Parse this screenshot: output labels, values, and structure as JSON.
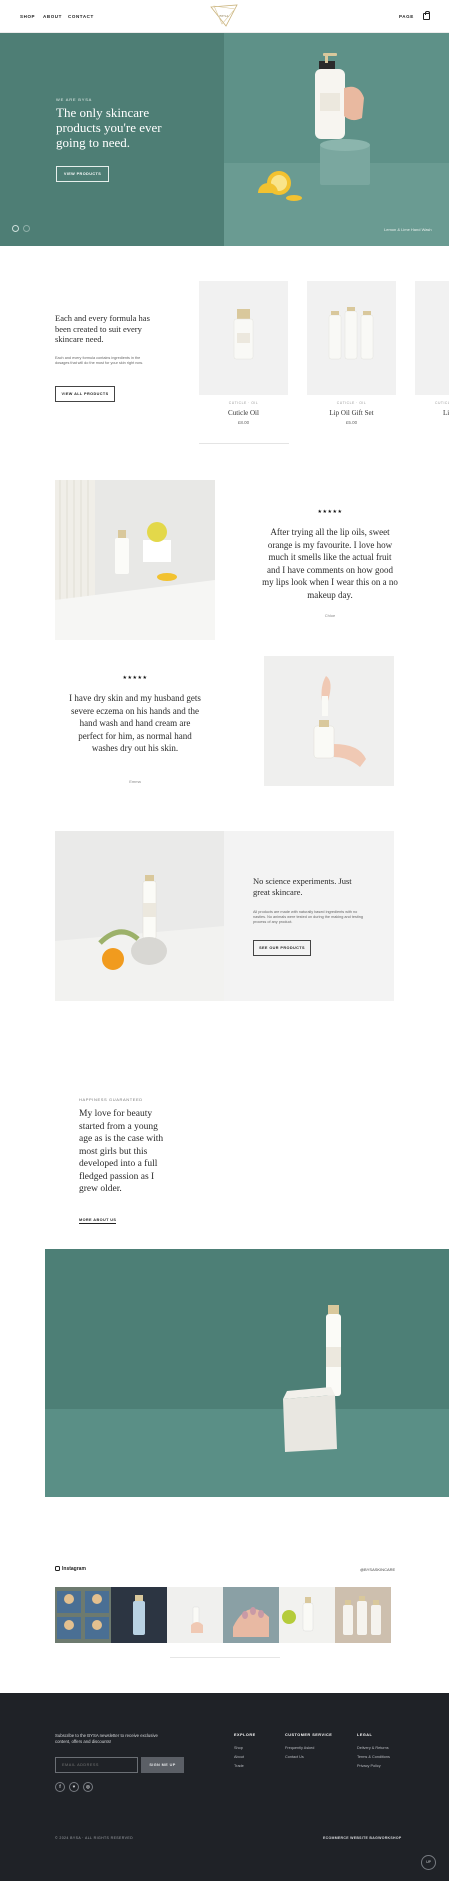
{
  "header": {
    "nav": [
      "SHOP",
      "ABOUT",
      "CONTACT"
    ],
    "logo_text": "BYSA",
    "search_label": "PAGE",
    "colors": {
      "accent": "#c9b27a"
    }
  },
  "hero": {
    "eyebrow": "WE ARE BYSA",
    "title": "The only skincare products you're ever going to need.",
    "button": "VIEW PRODUCTS",
    "caption": "Lemon & Lime Hand Wash",
    "colors": {
      "background": "#4e7e75",
      "photo": "#5e9188"
    }
  },
  "intro": {
    "title": "Each and every formula has been created to suit every skincare need.",
    "text": "Each and every formula contains ingredients in the dosages that will do the most for your skin right now.",
    "button": "VIEW ALL PRODUCTS"
  },
  "products": [
    {
      "meta": "CUTICLE · OIL",
      "name": "Cuticle Oil",
      "price": "£8.00"
    },
    {
      "meta": "CUTICLE · OIL",
      "name": "Lip Oil Gift Set",
      "price": "£5.00"
    },
    {
      "meta": "CUTICLE",
      "name": "Li",
      "price": ""
    }
  ],
  "testimonials": [
    {
      "stars": "★★★★★",
      "text": "After trying all the lip oils, sweet orange is my favourite. I love how much it smells like the actual fruit and I have comments on how good my lips look when I wear this on a no makeup day.",
      "author": "Chloe"
    },
    {
      "stars": "★★★★★",
      "text": "I have dry skin and my husband gets severe eczema on his hands and the hand wash and hand cream are perfect for him, as normal hand washes dry out his skin.",
      "author": "Emma"
    }
  ],
  "feature": {
    "title": "No science experiments. Just great skincare.",
    "text": "All products are made with naturally based ingredients with no nasties. No animals were tested on during the making and testing process of any product.",
    "button": "SEE OUR PRODUCTS"
  },
  "about": {
    "eyebrow": "HAPPINESS GUARANTEED",
    "text": "My love for beauty started from a young age as is the case with most girls but this developed into a full fledged passion as I grew older.",
    "link": "MORE ABOUT US"
  },
  "instagram": {
    "title": "Instagram",
    "handle": "@BYSASKINCARE"
  },
  "footer": {
    "newsletter_text": "Subscribe to the BYSA newsletter to receive exclusive content, offers and discounts!",
    "email_placeholder": "EMAIL ADDRESS",
    "signup_button": "SIGN ME UP",
    "social": [
      "f",
      "♥",
      "◎"
    ],
    "columns": [
      {
        "heading": "EXPLORE",
        "links": [
          "Shop",
          "About",
          "Trade"
        ]
      },
      {
        "heading": "CUSTOMER SERVICE",
        "links": [
          "Frequently Asked",
          "Contact Us"
        ]
      },
      {
        "heading": "LEGAL",
        "links": [
          "Delivery & Returns",
          "Terms & Conditions",
          "Privacy Policy"
        ]
      }
    ],
    "copyright": "© 2024 BYSA  ·  ALL RIGHTS RESERVED",
    "credit": "ECOMMERCE WEBSITE BAGWORKSHOP",
    "up_label": "UP",
    "colors": {
      "background": "#1f2227"
    }
  }
}
